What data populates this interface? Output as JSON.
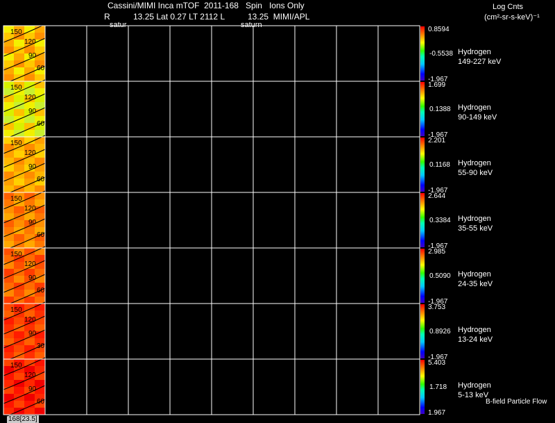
{
  "header": {
    "line1": "Cassini/MIMI Inca mTOF  2011-168   Spin   Ions Only",
    "line2": "R          13.25 Lat 0.27 LT 2112 L          13.25  MIMI/APL",
    "overlay_left": "satur",
    "overlay_right": "saturn"
  },
  "colorbar_title": {
    "line1": "Log Cnts",
    "line2": "(cm²-sr-s-keV)⁻¹"
  },
  "footer": {
    "left": "168[23.5]",
    "right": "B-field Particle Flow"
  },
  "colors": {
    "background": "#000000",
    "grid": "#ffffff",
    "contour": "#000000"
  },
  "chart_data": {
    "type": "heatmap",
    "grid": true,
    "grid_columns": 9,
    "species": "Hydrogen",
    "contour_labels": [
      "150",
      "120",
      "90",
      "60"
    ],
    "panels": [
      {
        "species": "Hydrogen",
        "energy": "149-227 keV",
        "cmax": "0.8594",
        "cmid": "-0.5538",
        "cmin": "-1.967",
        "palette": [
          "#f4f000",
          "#ffc800",
          "#ffa800",
          "#ff9000"
        ],
        "contour_bottom": "60"
      },
      {
        "species": "Hydrogen",
        "energy": "90-149 keV",
        "cmax": "1.699",
        "cmid": "0.1388",
        "cmin": "-1.967",
        "palette": [
          "#f0f000",
          "#d8f000",
          "#c8f030",
          "#ffc000"
        ],
        "contour_bottom": "60"
      },
      {
        "species": "Hydrogen",
        "energy": "55-90 keV",
        "cmax": "2.201",
        "cmid": "0.1168",
        "cmin": "-1.967",
        "palette": [
          "#ffa000",
          "#ffb800",
          "#ffd000",
          "#ff8c00"
        ],
        "contour_bottom": "60"
      },
      {
        "species": "Hydrogen",
        "energy": "35-55 keV",
        "cmax": "2.644",
        "cmid": "0.3384",
        "cmin": "-1.967",
        "palette": [
          "#ff7800",
          "#ff9000",
          "#ffa800",
          "#ff6000"
        ],
        "contour_bottom": "60"
      },
      {
        "species": "Hydrogen",
        "energy": "24-35 keV",
        "cmax": "2.985",
        "cmid": "0.5090",
        "cmin": "-1.967",
        "palette": [
          "#ff5000",
          "#ff6c00",
          "#ff8800",
          "#ff3c00"
        ],
        "contour_bottom": "60"
      },
      {
        "species": "Hydrogen",
        "energy": "13-24 keV",
        "cmax": "3.753",
        "cmid": "0.8926",
        "cmin": "-1.967",
        "palette": [
          "#ff3000",
          "#ff4800",
          "#ff6000",
          "#ff1c00"
        ],
        "contour_bottom": "30"
      },
      {
        "species": "Hydrogen",
        "energy": "5-13 keV",
        "cmax": "5.403",
        "cmid": "1.718",
        "cmin": "1.967",
        "palette": [
          "#ff1400",
          "#ff2800",
          "#ff4400",
          "#f00000"
        ],
        "contour_bottom": "60"
      }
    ]
  }
}
